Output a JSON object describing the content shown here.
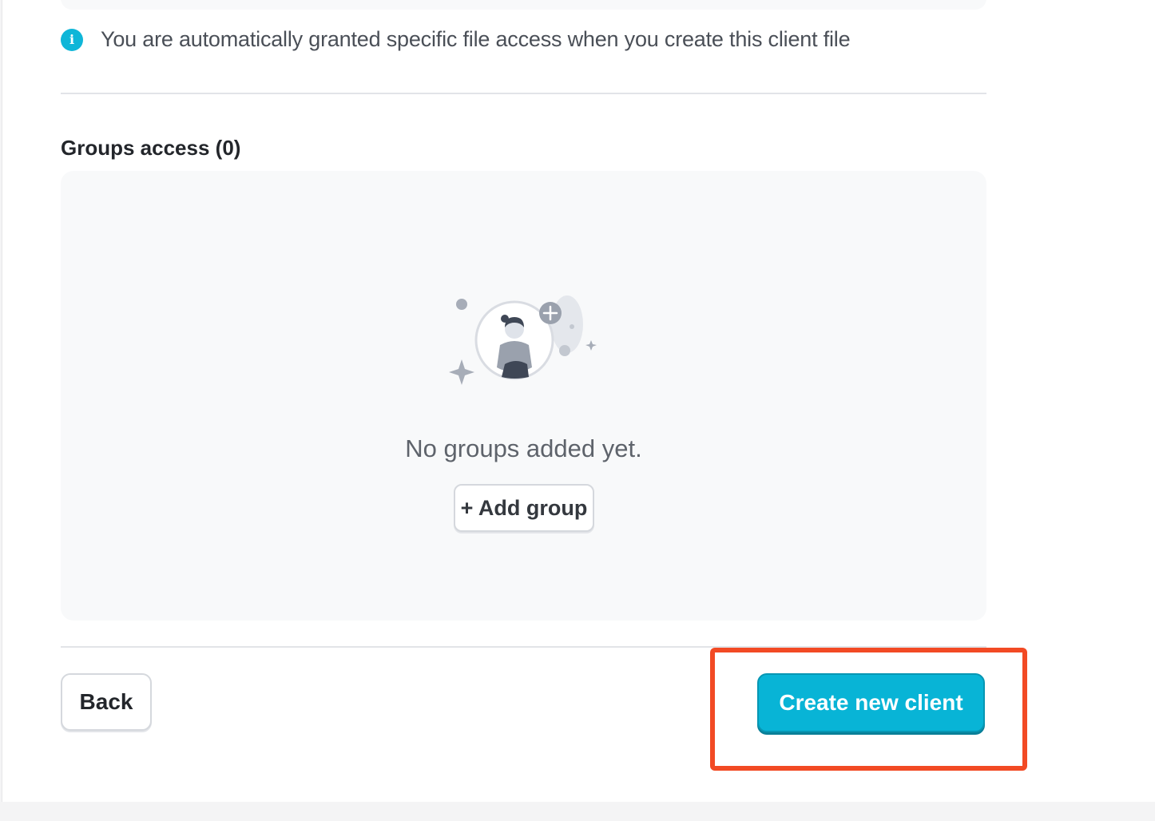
{
  "info": {
    "icon": "info-icon",
    "icon_glyph": "i",
    "text": "You are automatically granted specific file access when you create this client file",
    "icon_color": "#0fb6d8"
  },
  "groups_section": {
    "title": "Groups access (0)",
    "empty_message": "No groups added yet.",
    "add_button_label": "+ Add group",
    "illustration_icon": "person-add-illustration"
  },
  "footer": {
    "back_label": "Back",
    "create_label": "Create new client",
    "primary_color": "#08b4d6",
    "highlight_color": "#f24a24"
  }
}
